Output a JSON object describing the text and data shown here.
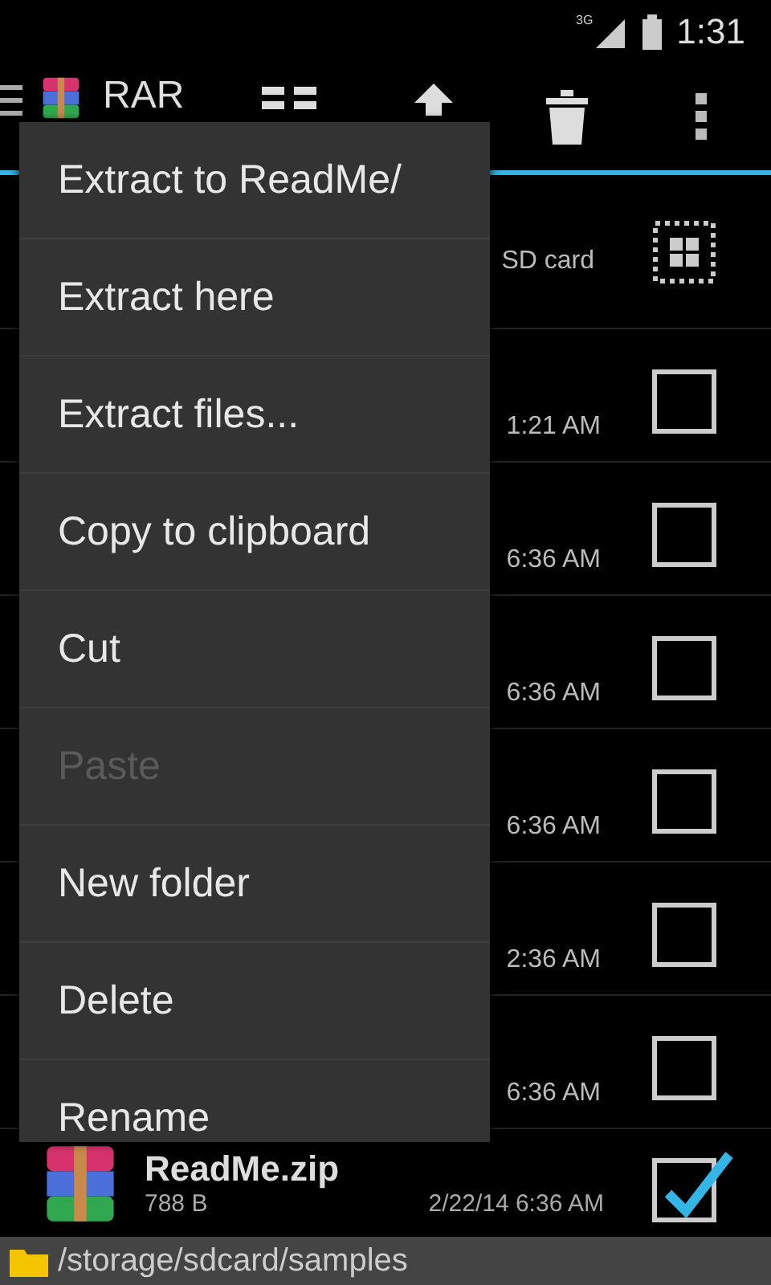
{
  "status_bar": {
    "network": "3G",
    "time": "1:31"
  },
  "app_bar": {
    "title": "RAR"
  },
  "file_list": {
    "header": {
      "location": "SD card"
    },
    "rows": [
      {
        "modified": "1:21 AM",
        "checked": false
      },
      {
        "modified": "6:36 AM",
        "checked": false
      },
      {
        "modified": "6:36 AM",
        "checked": false
      },
      {
        "modified": "6:36 AM",
        "checked": false
      },
      {
        "modified": "2:36 AM",
        "checked": false
      },
      {
        "modified": "6:36 AM",
        "checked": false
      }
    ],
    "file": {
      "name": "ReadMe.zip",
      "size": "788 B",
      "modified": "2/22/14 6:36 AM",
      "checked": true
    }
  },
  "context_menu": {
    "items": [
      {
        "label": "Extract to ReadMe/",
        "disabled": false
      },
      {
        "label": "Extract here",
        "disabled": false
      },
      {
        "label": "Extract files...",
        "disabled": false
      },
      {
        "label": "Copy to clipboard",
        "disabled": false
      },
      {
        "label": "Cut",
        "disabled": false
      },
      {
        "label": "Paste",
        "disabled": true
      },
      {
        "label": "New folder",
        "disabled": false
      },
      {
        "label": "Delete",
        "disabled": false
      },
      {
        "label": "Rename",
        "disabled": false
      }
    ]
  },
  "path_bar": {
    "path": "/storage/sdcard/samples"
  }
}
